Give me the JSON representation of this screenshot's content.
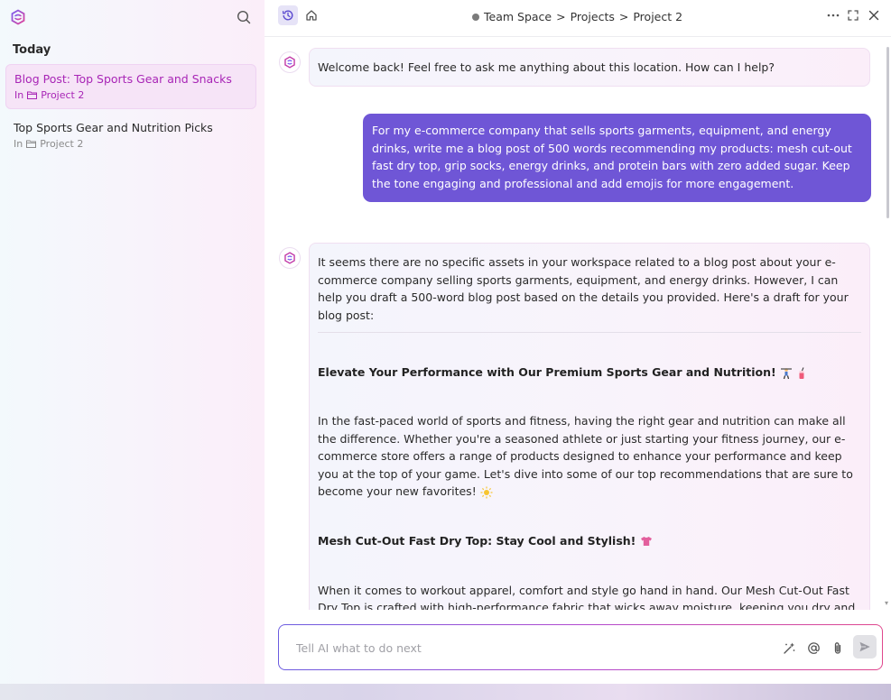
{
  "sidebar": {
    "heading": "Today",
    "conversations": [
      {
        "title": "Blog Post: Top Sports Gear and Snacks",
        "meta_prefix": "In",
        "location": "Project 2",
        "active": true
      },
      {
        "title": "Top Sports Gear and Nutrition Picks",
        "meta_prefix": "In",
        "location": "Project 2",
        "active": false
      }
    ]
  },
  "header": {
    "breadcrumb": [
      "Team Space",
      "Projects",
      "Project 2"
    ],
    "separator": ">"
  },
  "chat": {
    "welcome": "Welcome back! Feel free to ask me anything about this location. How can I help?",
    "user_message": "For my e-commerce company that sells sports garments, equipment, and energy drinks, write me a blog post of 500 words recommending my products: mesh cut-out fast dry top, grip socks, energy drinks, and protein bars with zero added sugar. Keep the tone engaging and professional and add emojis for more engagement.",
    "ai_intro": "It seems there are no specific assets in your workspace related to a blog post about your e-commerce company selling sports garments, equipment, and energy drinks. However, I can help you draft a 500-word blog post based on the details you provided. Here's a draft for your blog post:",
    "ai_heading1": "Elevate Your Performance with Our Premium Sports Gear and Nutrition!",
    "ai_paragraph1": "In the fast-paced world of sports and fitness, having the right gear and nutrition can make all the difference. Whether you're a seasoned athlete or just starting your fitness journey, our e-commerce store offers a range of products designed to enhance your performance and keep you at the top of your game. Let's dive into some of our top recommendations that are sure to become your new favorites!",
    "ai_heading2": "Mesh Cut-Out Fast Dry Top: Stay Cool and Stylish!",
    "ai_paragraph2": "When it comes to workout apparel, comfort and style go hand in hand. Our Mesh Cut-Out Fast Dry Top is crafted with high-performance fabric that wicks away moisture, keeping you dry and comfortable during even the most intense workouts. The stylish mesh cut-out design not only adds a trendy touch but also enhances breathability, ensuring you stay cool as you push your limits. Pair it with your favorite"
  },
  "input": {
    "placeholder": "Tell AI what to do next",
    "value": ""
  },
  "icons": {
    "logo": "clickup-brain-logo",
    "search": "search-icon",
    "history": "history-icon",
    "home": "home-icon",
    "more": "more-icon",
    "expand": "expand-icon",
    "close": "close-icon",
    "magic": "sparkle-icon",
    "mention": "at-icon",
    "attach": "paperclip-icon",
    "send": "send-icon"
  },
  "colors": {
    "accent": "#a825b6",
    "user_bubble": "#6f56d6"
  }
}
